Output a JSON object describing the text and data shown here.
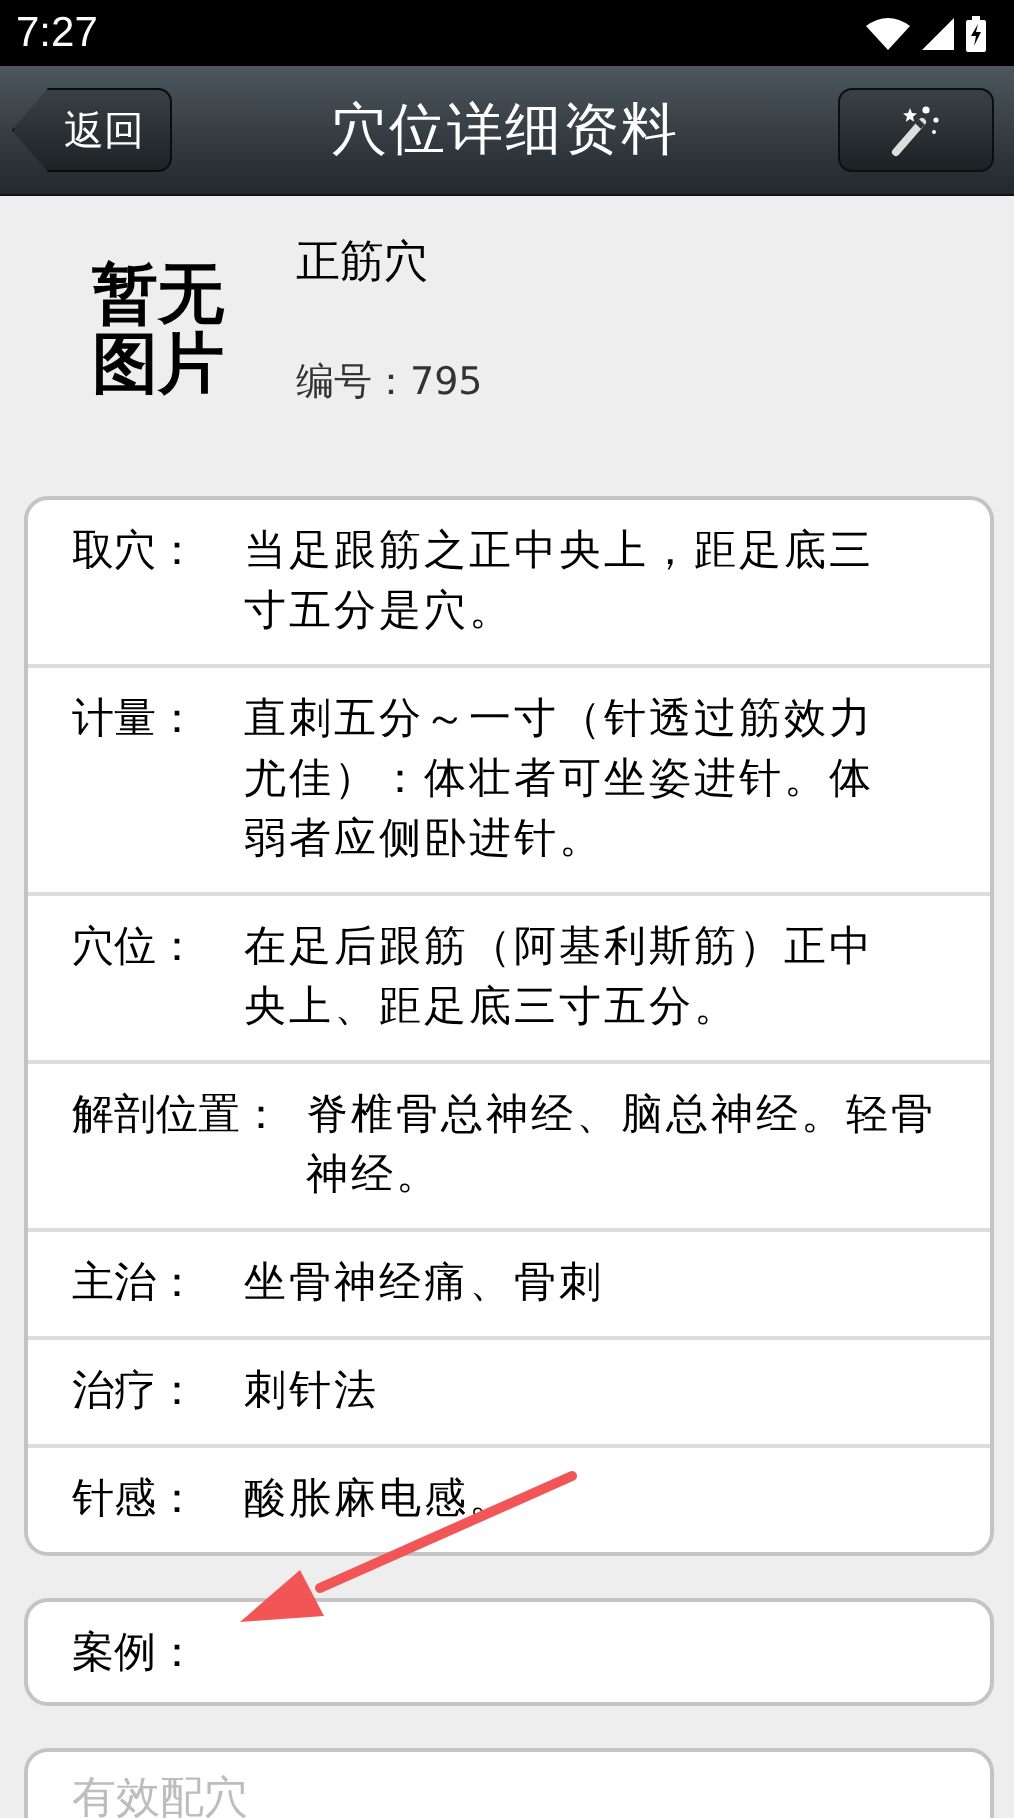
{
  "status_bar": {
    "time": "7:27"
  },
  "nav_bar": {
    "back_button": "返回",
    "title": "穴位详细资料"
  },
  "header": {
    "image_placeholder": "暂无图片",
    "name": "正筋穴",
    "number": "编号：795"
  },
  "details": [
    {
      "label": "取穴：",
      "value": "当足跟筋之正中央上，距足底三寸五分是穴。"
    },
    {
      "label": "计量：",
      "value": "直刺五分～一寸（针透过筋效力尤佳）：体壮者可坐姿进针。体弱者应侧卧进针。"
    },
    {
      "label": "穴位：",
      "value": "在足后跟筋（阿基利斯筋）正中央上、距足底三寸五分。"
    },
    {
      "label": "解剖位置：",
      "value": "脊椎骨总神经、脑总神经。轻骨神经。"
    },
    {
      "label": "主治：",
      "value": "坐骨神经痛、骨刺"
    },
    {
      "label": "治疗：",
      "value": "刺针法"
    },
    {
      "label": "针感：",
      "value": "酸胀麻电感。"
    }
  ],
  "case": {
    "label": "案例："
  },
  "matching_field": {
    "placeholder": "有效配穴"
  }
}
